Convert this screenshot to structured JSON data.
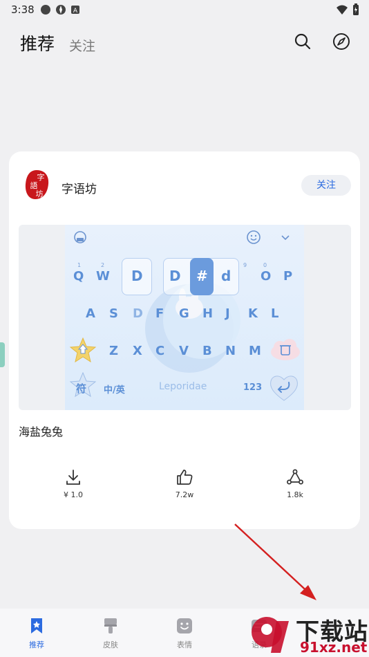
{
  "status_bar": {
    "time": "3:38"
  },
  "header": {
    "tab_recommend": "推荐",
    "tab_follow": "关注",
    "search_icon": "search-icon",
    "compass_icon": "compass-icon"
  },
  "card": {
    "author_name": "字语坊",
    "avatar_text": "字语坊",
    "follow_label": "关注",
    "skin_title": "海盐兔兔",
    "keyboard_preview": {
      "row1": [
        "Q",
        "W",
        "D",
        "D",
        "#",
        "d",
        "O",
        "P"
      ],
      "row2": [
        "A",
        "S",
        "D",
        "F",
        "G",
        "H",
        "J",
        "K",
        "L"
      ],
      "row3": [
        "Z",
        "X",
        "C",
        "V",
        "B",
        "N",
        "M"
      ],
      "sym_key": "符",
      "lang_key": "中/英",
      "space_text": "Leporidae",
      "num_key": "123"
    },
    "stats": [
      {
        "icon": "download-icon",
        "value": "¥ 1.0"
      },
      {
        "icon": "thumbs-up-icon",
        "value": "7.2w"
      },
      {
        "icon": "share-icon",
        "value": "1.8k"
      }
    ]
  },
  "bottom_nav": [
    {
      "icon": "bookmark-icon",
      "label": "推荐",
      "active": true
    },
    {
      "icon": "brush-icon",
      "label": "皮肤",
      "active": false
    },
    {
      "icon": "emoji-icon",
      "label": "表情",
      "active": false
    },
    {
      "icon": "quote-icon",
      "label": "语录",
      "active": false
    }
  ],
  "watermark": {
    "main": "下载站",
    "sub": "91xz.net"
  },
  "colors": {
    "accent": "#2c6be0",
    "background": "#f0f0f2",
    "arrow": "#d42020"
  }
}
